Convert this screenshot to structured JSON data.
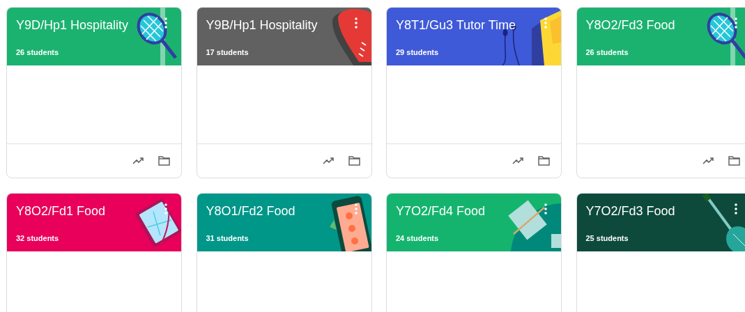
{
  "classes": [
    {
      "title": "Y9D/Hp1 Hospitality",
      "students": "26 students",
      "color": "#1bb270",
      "kind": "racket"
    },
    {
      "title": "Y9B/Hp1 Hospitality",
      "students": "17 students",
      "color": "#616161",
      "kind": "glove"
    },
    {
      "title": "Y8T1/Gu3 Tutor Time",
      "students": "29 students",
      "color": "#3f5ad8",
      "kind": "earphones"
    },
    {
      "title": "Y8O2/Fd3 Food",
      "students": "26 students",
      "color": "#1bb270",
      "kind": "racket"
    },
    {
      "title": "Y8O2/Fd1 Food",
      "students": "32 students",
      "color": "#e8005a",
      "kind": "tablet"
    },
    {
      "title": "Y8O1/Fd2 Food",
      "students": "31 students",
      "color": "#009688",
      "kind": "phone"
    },
    {
      "title": "Y7O2/Fd4 Food",
      "students": "24 students",
      "color": "#15b46e",
      "kind": "notebook"
    },
    {
      "title": "Y7O2/Fd3 Food",
      "students": "25 students",
      "color": "#0d4a3c",
      "kind": "guitar"
    }
  ]
}
